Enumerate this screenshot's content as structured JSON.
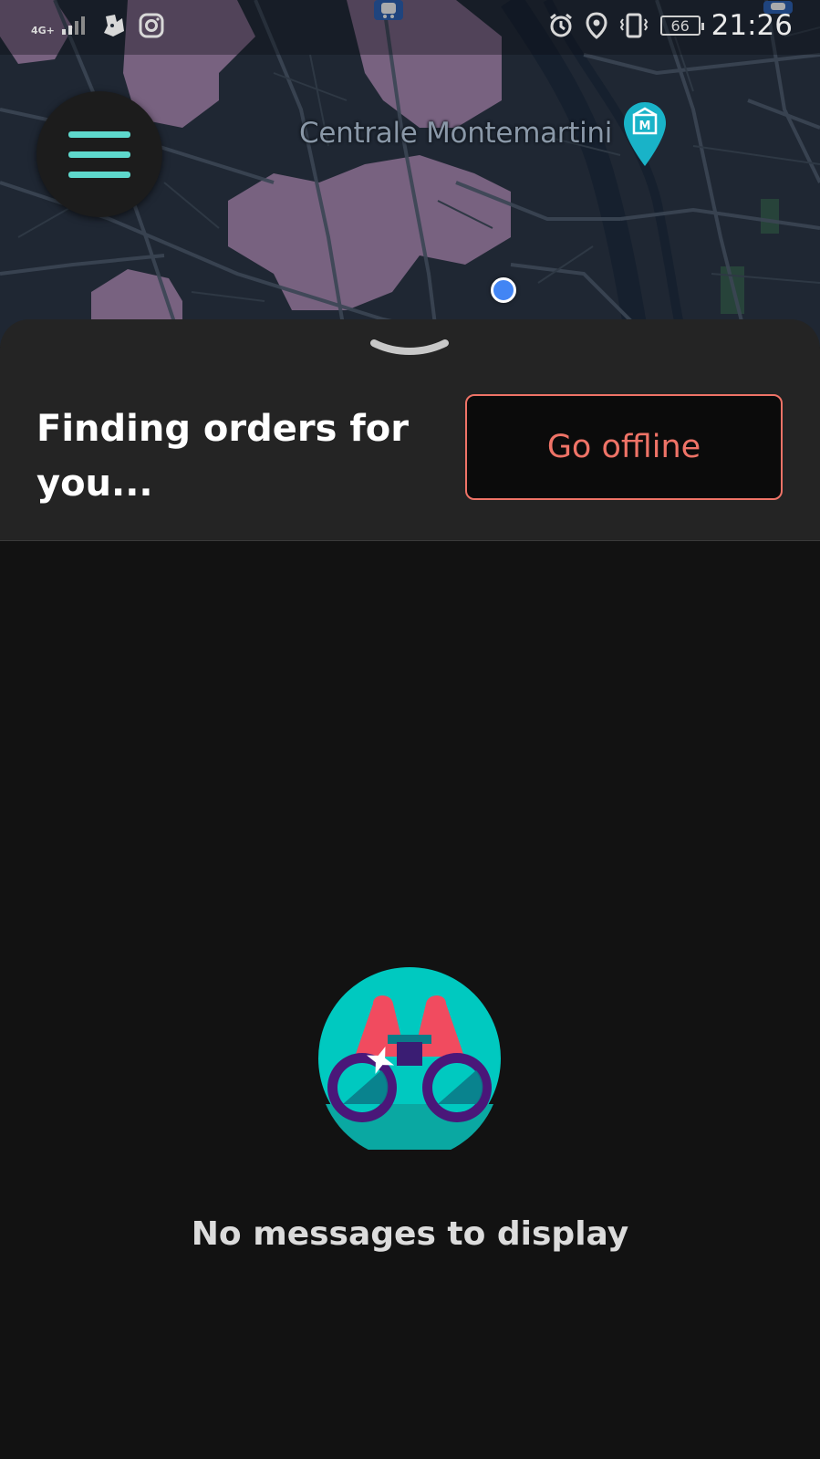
{
  "status_bar": {
    "network": "4G+",
    "time": "21:26",
    "battery_level": "66",
    "icons": [
      "signal-icon",
      "deliveroo-icon",
      "instagram-icon",
      "alarm-icon",
      "location-icon",
      "vibrate-icon",
      "battery-icon"
    ]
  },
  "map": {
    "poi_label": "Centrale Montemartini",
    "poi_icon": "museum-pin-icon",
    "zone_color": "#8c6f91"
  },
  "menu": {
    "icon": "hamburger-menu-icon",
    "accent": "#5ed8cc"
  },
  "sheet": {
    "status_title": "Finding orders for you...",
    "go_offline_label": "Go offline",
    "go_offline_color": "#ef7367"
  },
  "empty_state": {
    "icon": "binoculars-icon",
    "message": "No messages to display"
  }
}
